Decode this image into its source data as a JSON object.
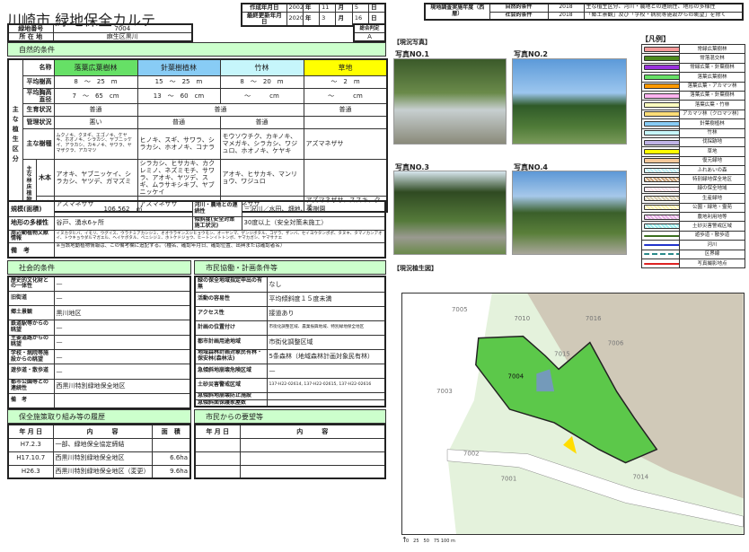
{
  "title": "川崎市 緑地保全カルテ",
  "dates": {
    "created_label": "作成年月日",
    "created": [
      "2002",
      "年",
      "11",
      "月",
      "5",
      "日"
    ],
    "updated_label": "最終更新年月日",
    "updated": [
      "2020",
      "年",
      "3",
      "月",
      "16",
      "日"
    ]
  },
  "survey": {
    "label": "現地調査実施年度（西暦）",
    "rows": [
      {
        "type": "自然的条件",
        "year": "2018",
        "note": "主な植生区分、河川・農地との連続性、地形の多様性"
      },
      {
        "type": "社会的条件",
        "year": "2018",
        "note": "「郷土景観」及び「学校・病院等施設からの眺望」を除く"
      }
    ]
  },
  "info": {
    "number_label": "緑地番号",
    "number": "7004",
    "location_label": "所 在 地",
    "location": "麻生区黒川",
    "rating_label": "総合判定",
    "rating": "A"
  },
  "natural": {
    "header": "自然的条件",
    "side_label": "主な植生区分",
    "plants_label": "主な林床植物",
    "row_labels": {
      "name": "名称",
      "height": "平均樹高",
      "diameter": "平均胸高直径",
      "growth": "生育状況",
      "management": "管理状況",
      "species": "主な樹種",
      "woody": "木本",
      "herb": "草本"
    },
    "columns": [
      {
        "name": "落葉広葉樹林",
        "color": "#66e066",
        "height": "8　～　25　m",
        "diameter": "7　～　65　cm",
        "growth": "普通",
        "management": "悪い",
        "species": "ムクノキ、クヌギ、エゴノキ、ケヤキ、ホオノキ、シラカシ、ヤブニッケイ、アラカシ、カキノキ、サワラ、ヤマザクラ、アカマツ",
        "woody": "アオキ、ヤブニッケイ、シラカシ、ヤツデ、ガマズミ",
        "herb": "アズマネザサ"
      },
      {
        "name": "針葉樹植林",
        "color": "#88ccf5",
        "height": "15　～　25　m",
        "diameter": "13　～　60　cm",
        "growth": "普通",
        "management": "普通",
        "species": "ヒノキ、スギ、サワラ、シラカシ、ホオノキ、コナラ",
        "woody": "シラカシ、ヒサカキ、カクレミノ、ネズミモチ、サワラ、アオキ、ヤツデ、スギ、ムラサキシキブ、ヤブニッケイ",
        "herb": "アズマネザサ"
      },
      {
        "name": "竹林",
        "color": "#c6f6fb",
        "height": "8　～　20　m",
        "diameter": "～　　　cm",
        "growth": "普通",
        "management": "普通",
        "species": "モウソウチク、カキノキ、マメガキ、シラカシ、ワジュロ、ホオノキ、ケヤキ",
        "woody": "アオキ、ヒサカキ、マンリョウ、ワジュロ",
        "herb": "アズマネザサ"
      },
      {
        "name": "草地",
        "color": "#ffff00",
        "height": "～　2　m",
        "diameter": "～　　　cm",
        "growth": "",
        "management": "",
        "species": "アズマネザサ",
        "woody": "",
        "herb": "アズマネザサ、ススキ、クズ"
      }
    ],
    "scale_label": "規模(面積)",
    "scale": "106,562　㎡",
    "continuity_label": "河川・農地との連続性",
    "continuity": "三沢川／水田、畑地、果樹園",
    "terrain_label": "地形の多様性",
    "terrain": "谷戸、湧水6ヶ所",
    "slope_label": "傾斜度(安全対策施工状況)",
    "slope": "30度以上（安全対策未施工）",
    "fauna_label": "周辺動植物文献情報",
    "fauna": "イヌカタヒバ、イモリ、ウグイス、ウラナミアカシジミ、オオウラギンスジヒョウモン、オーヤンマ、ゲンジボタル、コゲラ、ザンバ、セイヨウタンポポ、タヌキ、タマノカンアオイ、トウキョウダルマガエル、ヘイケボタル、ベニシジミ、ホトケドジョウ、ヒートンイトトンボ、ヤマカガシ、ヤマサナエ",
    "remarks_label": "備　考",
    "remarks": "※当該地動植物情報は、この備考欄に追記する。（種名、確認年月日、確認位置、出典または確認者名）"
  },
  "social": {
    "header": "社会的条件",
    "rows": [
      {
        "label": "歴史的文化財との一体性",
        "value": "—"
      },
      {
        "label": "旧街道",
        "value": "—"
      },
      {
        "label": "郷土景観",
        "value": "黒川地区"
      },
      {
        "label": "鉄道駅等からの眺望",
        "value": "—"
      },
      {
        "label": "主要道路からの眺望",
        "value": "—"
      },
      {
        "label": "学校・病院等施設からの眺望",
        "value": "—"
      },
      {
        "label": "遊歩道・散歩道",
        "value": "—"
      },
      {
        "label": "都市公園等との連続性",
        "value": "西黒川特別緑地保全地区"
      },
      {
        "label": "備　考",
        "value": ""
      }
    ]
  },
  "civic": {
    "header": "市民協働・計画条件等",
    "rows": [
      {
        "label": "緑の保全地域指定申出の有無",
        "value": "なし"
      },
      {
        "label": "活動の容易性",
        "value": "平均傾斜度１５度未満"
      },
      {
        "label": "アクセス性",
        "value": "接道あり"
      },
      {
        "label": "計画の位置付け",
        "value": "市街化調整区域、農業振興地域、特別緑地保全地区"
      },
      {
        "label": "都市計画用途地域",
        "value": "市街化調整区域"
      },
      {
        "label": "地域森林計画対象民有林・保安林(森林法)",
        "value": "5条森林（地域森林計画対象民有林）"
      },
      {
        "label": "急傾斜地崩壊危険区域",
        "value": "—"
      },
      {
        "label": "土砂災害警戒区域",
        "value": "137-H22-02614, 137-H22-02615, 137-H22-02616"
      },
      {
        "label": "急傾斜地崩壊防止施設",
        "value": ""
      },
      {
        "label": "急傾斜面保護家屋数",
        "value": ""
      }
    ]
  },
  "history": {
    "header": "保全施策取り組み等の履歴",
    "columns": [
      "年 月 日",
      "内　　　容",
      "面　積"
    ],
    "rows": [
      {
        "date": "H7.2.3",
        "content": "一部、緑地保全協定締結",
        "area": ""
      },
      {
        "date": "H17.10.7",
        "content": "西黒川特別緑地保全地区",
        "area": "6.6ha"
      },
      {
        "date": "H26.3",
        "content": "西黒川特別緑地保全地区（変更）",
        "area": "9.6ha"
      }
    ]
  },
  "requests": {
    "header": "市民からの要望等",
    "columns": [
      "年 月 日",
      "内　　　容"
    ]
  },
  "photos": {
    "header": "【現況写真】",
    "items": [
      {
        "label": "写真NO.1"
      },
      {
        "label": "写真NO.2"
      },
      {
        "label": "写真NO.3"
      },
      {
        "label": "写真NO.4"
      }
    ]
  },
  "legend": {
    "header": "【凡例】",
    "items": [
      {
        "label": "常緑広葉樹林",
        "color": "#f59999"
      },
      {
        "label": "常落混交林",
        "color": "#4d8a1e"
      },
      {
        "label": "常緑広葉・針葉樹林",
        "color": "#9933dd"
      },
      {
        "label": "落葉広葉樹林",
        "color": "#66e066"
      },
      {
        "label": "落葉広葉・アカマツ林",
        "color": "#ff9900"
      },
      {
        "label": "落葉広葉・針葉樹林",
        "color": "#ffb3f0"
      },
      {
        "label": "落葉広葉・竹林",
        "color": "#ffffc0"
      },
      {
        "label": "アカマツ林（クロマツ林）",
        "color": "#ffdd77"
      },
      {
        "label": "針葉樹植林",
        "color": "#88ccf5"
      },
      {
        "label": "竹林",
        "color": "#c6f6fb"
      },
      {
        "label": "伐採跡地",
        "color": "#c0b3e6"
      },
      {
        "label": "草地",
        "color": "#ffff00"
      },
      {
        "label": "復元緑地",
        "color": "#f5c89a"
      },
      {
        "label": "ふれあいの森",
        "color": "#bfeef5"
      },
      {
        "label": "特別緑地保全地区",
        "color": "#c8a27a"
      },
      {
        "label": "緑の保全地域",
        "color": "#ffe0e8"
      },
      {
        "label": "生産緑地",
        "color": "#d8ceb0"
      },
      {
        "label": "公園・緑地・霊苑",
        "color": "#fff3b0"
      },
      {
        "label": "農地利用地等",
        "color": "#e8b0e8"
      },
      {
        "label": "土砂災害警戒区域",
        "color": "#9ff0f0"
      },
      {
        "label": "遊歩道・散歩道",
        "color": "#3a6e1e"
      },
      {
        "label": "河川",
        "color": "#2233cc"
      },
      {
        "label": "区界線",
        "color": "#2a8a8a"
      },
      {
        "label": "写真撮影地点",
        "color": "#dd2222"
      }
    ]
  },
  "map": {
    "header": "【現況植生図】",
    "labels": [
      "7005",
      "7010",
      "7016",
      "7006",
      "7015",
      "7004",
      "7003",
      "7002",
      "7001",
      "7014"
    ],
    "scale": "0　25　50　75 100 m"
  }
}
